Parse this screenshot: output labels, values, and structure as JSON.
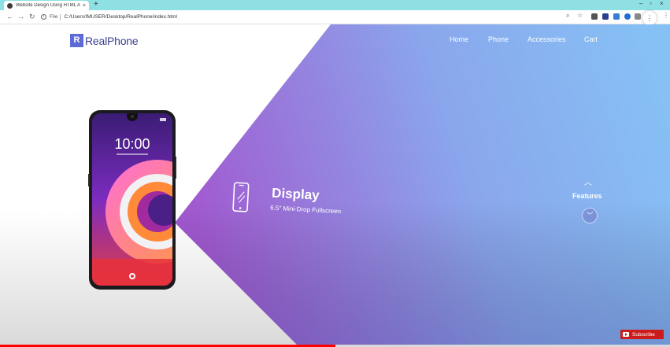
{
  "browser": {
    "tab_title": "Website Design Using HTML And",
    "address_scheme": "File",
    "address_url": "C:/Users/IMUSER/Desktop/RealPhone/index.html",
    "colors": {
      "tabbar": "#8ee0e2"
    }
  },
  "brand": {
    "mark": "R",
    "name": "RealPhone",
    "color": "#3a3f8f",
    "mark_color": "#5c6bd8"
  },
  "nav": {
    "items": [
      "Home",
      "Phone",
      "Accessories",
      "Cart"
    ]
  },
  "phone_screen": {
    "time": "10:00"
  },
  "feature": {
    "title": "Display",
    "subtitle": "6.5\" Mini-Drop Fullscreen"
  },
  "slider": {
    "label": "Features"
  },
  "hero_colors": {
    "purple": "#a15ad0",
    "periwinkle": "#8aa6ec",
    "sky": "#86c1f5"
  },
  "overlay": {
    "subscribe_label": "Subscribe",
    "progress_fraction": 0.5
  }
}
